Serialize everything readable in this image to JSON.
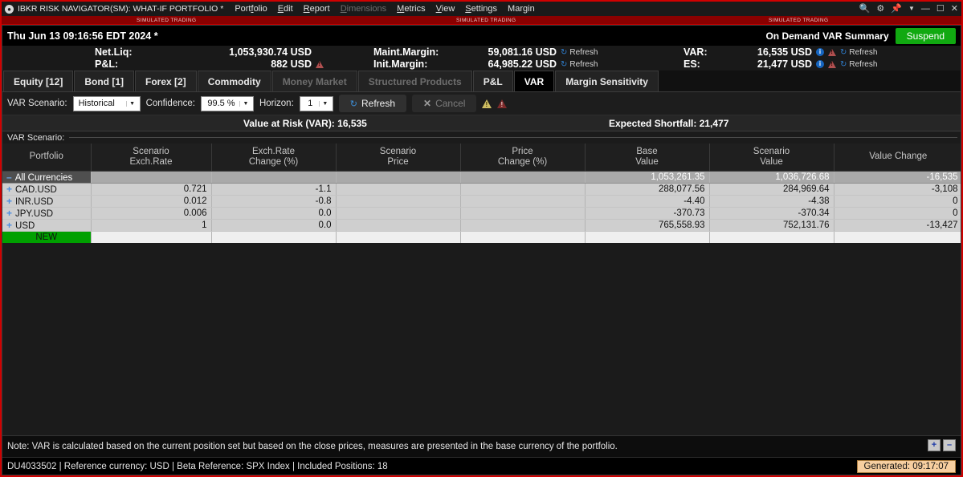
{
  "titlebar": {
    "logo": "circle-logo-icon",
    "title": "IBKR RISK NAVIGATOR(SM): WHAT-IF PORTFOLIO *",
    "menu": [
      {
        "label": "Portfolio",
        "mnemonic": "f",
        "disabled": false
      },
      {
        "label": "Edit",
        "mnemonic": "E",
        "disabled": false
      },
      {
        "label": "Report",
        "mnemonic": "R",
        "disabled": false
      },
      {
        "label": "Dimensions",
        "mnemonic": "D",
        "disabled": true
      },
      {
        "label": "Metrics",
        "mnemonic": "M",
        "disabled": false
      },
      {
        "label": "View",
        "mnemonic": "V",
        "disabled": false
      },
      {
        "label": "Settings",
        "mnemonic": "S",
        "disabled": false
      },
      {
        "label": "Margin",
        "mnemonic": "g",
        "disabled": false
      }
    ],
    "controls": [
      "search-icon",
      "gear-icon",
      "pin-icon",
      "chevron-down-icon",
      "minimize-icon",
      "maximize-icon",
      "close-icon"
    ]
  },
  "sim_banner": {
    "text": "SIMULATED TRADING"
  },
  "header": {
    "datetime": "Thu Jun 13 09:16:56 EDT 2024 *",
    "on_demand_label": "On Demand VAR Summary",
    "suspend_label": "Suspend"
  },
  "summary": {
    "netliq_label": "Net.Liq:",
    "netliq_value": "1,053,930.74 USD",
    "pnl_label": "P&L:",
    "pnl_value": "882 USD",
    "maint_label": "Maint.Margin:",
    "maint_value": "59,081.16 USD",
    "maint_refresh": "Refresh",
    "init_label": "Init.Margin:",
    "init_value": "64,985.22 USD",
    "init_refresh": "Refresh",
    "var_label": "VAR:",
    "var_value": "16,535 USD",
    "var_refresh": "Refresh",
    "es_label": "ES:",
    "es_value": "21,477 USD",
    "es_refresh": "Refresh",
    "info_glyph": "i"
  },
  "tabs": [
    {
      "label": "Equity [12]",
      "active": false,
      "disabled": false
    },
    {
      "label": "Bond [1]",
      "active": false,
      "disabled": false
    },
    {
      "label": "Forex [2]",
      "active": false,
      "disabled": false
    },
    {
      "label": "Commodity",
      "active": false,
      "disabled": false
    },
    {
      "label": "Money Market",
      "active": false,
      "disabled": true
    },
    {
      "label": "Structured Products",
      "active": false,
      "disabled": true
    },
    {
      "label": "P&L",
      "active": false,
      "disabled": false
    },
    {
      "label": "VAR",
      "active": true,
      "disabled": false
    },
    {
      "label": "Margin Sensitivity",
      "active": false,
      "disabled": false
    }
  ],
  "controls": {
    "scenario_label": "VAR Scenario:",
    "scenario_value": "Historical",
    "confidence_label": "Confidence:",
    "confidence_value": "99.5 %",
    "horizon_label": "Horizon:",
    "horizon_value": "1",
    "refresh_label": "Refresh",
    "cancel_label": "Cancel",
    "warn_yellow": "warning-yellow-icon",
    "warn_red": "warning-red-icon"
  },
  "metrics_bar": {
    "var_text": "Value at Risk (VAR): 16,535",
    "es_text": "Expected Shortfall: 21,477"
  },
  "scenario_strip": {
    "label": "VAR Scenario:"
  },
  "table": {
    "columns": [
      "Portfolio",
      "Scenario\nExch.Rate",
      "Exch.Rate\nChange (%)",
      "Scenario\nPrice",
      "Price\nChange (%)",
      "Base\nValue",
      "Scenario\nValue",
      "Value Change"
    ],
    "columns_lines": [
      [
        "Portfolio",
        ""
      ],
      [
        "Scenario",
        "Exch.Rate"
      ],
      [
        "Exch.Rate",
        "Change (%)"
      ],
      [
        "Scenario",
        "Price"
      ],
      [
        "Price",
        "Change (%)"
      ],
      [
        "Base",
        "Value"
      ],
      [
        "Scenario",
        "Value"
      ],
      [
        "Value Change",
        ""
      ]
    ],
    "rows": [
      {
        "type": "total",
        "twisty": "minus",
        "portfolio": "All Currencies",
        "scenario_exch_rate": "",
        "exch_rate_change": "",
        "scenario_price": "",
        "price_change": "",
        "base_value": "1,053,261.35",
        "scenario_value": "1,036,726.68",
        "value_change": "-16,535"
      },
      {
        "type": "data",
        "twisty": "plus",
        "portfolio": "CAD.USD",
        "scenario_exch_rate": "0.721",
        "exch_rate_change": "-1.1",
        "scenario_price": "",
        "price_change": "",
        "base_value": "288,077.56",
        "scenario_value": "284,969.64",
        "value_change": "-3,108"
      },
      {
        "type": "data",
        "twisty": "plus",
        "portfolio": "INR.USD",
        "scenario_exch_rate": "0.012",
        "exch_rate_change": "-0.8",
        "scenario_price": "",
        "price_change": "",
        "base_value": "-4.40",
        "scenario_value": "-4.38",
        "value_change": "0"
      },
      {
        "type": "data",
        "twisty": "plus",
        "portfolio": "JPY.USD",
        "scenario_exch_rate": "0.006",
        "exch_rate_change": "0.0",
        "scenario_price": "",
        "price_change": "",
        "base_value": "-370.73",
        "scenario_value": "-370.34",
        "value_change": "0"
      },
      {
        "type": "data",
        "twisty": "plus",
        "portfolio": "USD",
        "scenario_exch_rate": "1",
        "exch_rate_change": "0.0",
        "scenario_price": "",
        "price_change": "",
        "base_value": "765,558.93",
        "scenario_value": "752,131.76",
        "value_change": "-13,427"
      },
      {
        "type": "new",
        "twisty": "",
        "portfolio": "NEW",
        "scenario_exch_rate": "",
        "exch_rate_change": "",
        "scenario_price": "",
        "price_change": "",
        "base_value": "",
        "scenario_value": "",
        "value_change": ""
      }
    ]
  },
  "footer": {
    "note": "Note: VAR is calculated based on the current position set but based on the close prices, measures are presented in the base currency of the portfolio.",
    "zoom_in": "+",
    "zoom_out": "–",
    "status": "DU4033502  |  Reference currency: USD  |  Beta Reference:  SPX Index  |  Included Positions: 18",
    "generated": "Generated: 09:17:07"
  },
  "colors": {
    "accent_red": "#d00000",
    "suspend_green": "#11a911",
    "new_green": "#00a000",
    "refresh_blue": "#2f7fd0",
    "generated_bg": "#f7cfa0"
  }
}
